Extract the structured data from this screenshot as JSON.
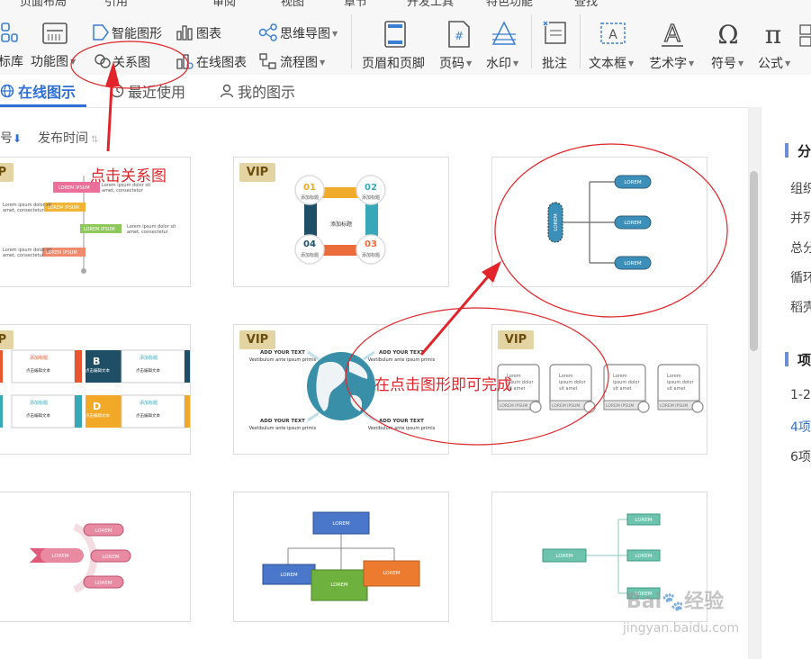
{
  "menu": {
    "items": [
      "页面布局",
      "引用",
      "审阅",
      "视图",
      "章节",
      "开发工具",
      "特色功能",
      "查找"
    ]
  },
  "toolbar": {
    "icon_library": "标库",
    "function_chart": "功能图",
    "smart_shape": "智能图形",
    "chart": "图表",
    "mindmap": "思维导图",
    "relation_chart": "关系图",
    "online_chart": "在线图表",
    "flowchart": "流程图",
    "header_footer": "页眉和页脚",
    "page_number": "页码",
    "watermark": "水印",
    "comment": "批注",
    "textbox": "文本框",
    "wordart": "艺术字",
    "symbol": "符号",
    "formula": "公式"
  },
  "tabs": {
    "online": "在线图示",
    "recent": "最近使用",
    "mine": "我的图示"
  },
  "sort": {
    "hot": "号",
    "publish_time": "发布时间"
  },
  "cards": {
    "vip": "VIP",
    "lorem": "LOREM",
    "lorem_ipsum": "LOREM IPSUM",
    "add_title": "添加标题",
    "step_titles": [
      "01",
      "02",
      "03",
      "04"
    ],
    "step_label": "添加标题",
    "globe_text": "ADD YOUR TEXT",
    "globe_sub": "Vestibulum ante ipsum primis",
    "info_small": "Lorem ipsum dolor sit amet, consectetur",
    "lettered": [
      "B",
      "D"
    ],
    "lettered_title": "添加标题",
    "lettered_sub": "点击编辑文本"
  },
  "right_panel": {
    "category_head": "分",
    "categories": [
      "组织",
      "并列",
      "总分",
      "循环",
      "稻壳"
    ],
    "items_head": "项",
    "items": [
      "1-2",
      "4项",
      "6项"
    ]
  },
  "annotations": {
    "click_relation": "点击关系图",
    "click_shape": "在点击图形即可完成"
  },
  "watermark": {
    "brand": "Bai",
    "brand_cn": "经验",
    "url": "jingyan.baidu.com"
  },
  "colors": {
    "accent_blue": "#2f6fd6",
    "annotation_red": "#e0242a",
    "vip_gold": "#e4d3a3"
  }
}
